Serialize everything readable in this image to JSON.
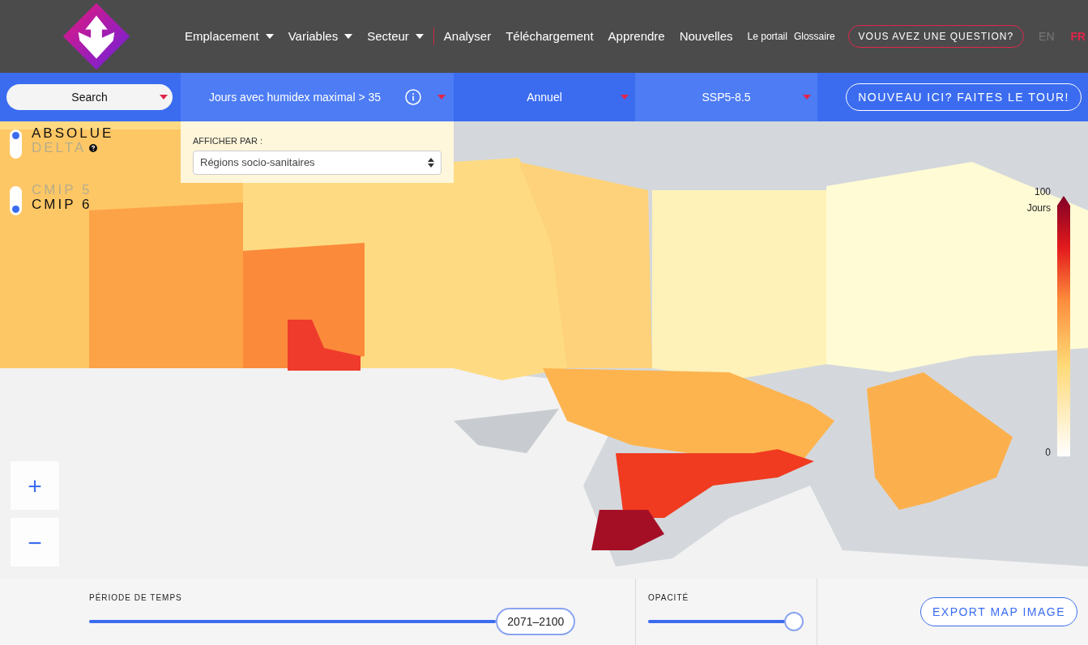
{
  "header": {
    "nav": [
      {
        "label": "Emplacement",
        "dropdown": true
      },
      {
        "label": "Variables",
        "dropdown": true
      },
      {
        "label": "Secteur",
        "dropdown": true
      },
      {
        "label": "Analyser",
        "dropdown": false
      },
      {
        "label": "Téléchargement",
        "dropdown": false
      },
      {
        "label": "Apprendre",
        "dropdown": false
      },
      {
        "label": "Nouvelles",
        "dropdown": false
      }
    ],
    "small_links": [
      "Le portail",
      "Glossaire"
    ],
    "question_button": "VOUS AVEZ UNE QUESTION?",
    "languages": [
      {
        "label": "EN",
        "selected": false
      },
      {
        "label": "FR",
        "selected": true
      }
    ]
  },
  "toolbar": {
    "search": {
      "placeholder": "Search"
    },
    "variable": "Jours avec humidex maximal > 35",
    "frequency": "Annuel",
    "scenario": "SSP5-8.5",
    "tour_button": "NOUVEAU ICI? FAITES LE TOUR!"
  },
  "value_mode": [
    {
      "label": "ABSOLUE",
      "selected": true,
      "help": false
    },
    {
      "label": "DELTA",
      "selected": false,
      "help": true
    }
  ],
  "model": [
    {
      "label": "CMIP 5",
      "selected": false
    },
    {
      "label": "CMIP 6",
      "selected": true
    }
  ],
  "display_by": {
    "label": "AFFICHER PAR :",
    "value": "Régions socio-sanitaires"
  },
  "legend": {
    "max": "100",
    "unit": "Jours",
    "min": "0"
  },
  "zoom": [
    "+",
    "−"
  ],
  "time_period": {
    "label": "PÉRIODE DE TEMPS",
    "value": "2071–2100",
    "level": 0.84
  },
  "opacity": {
    "label": "OPACITÉ",
    "level": 1
  },
  "export_button": "EXPORT MAP IMAGE"
}
